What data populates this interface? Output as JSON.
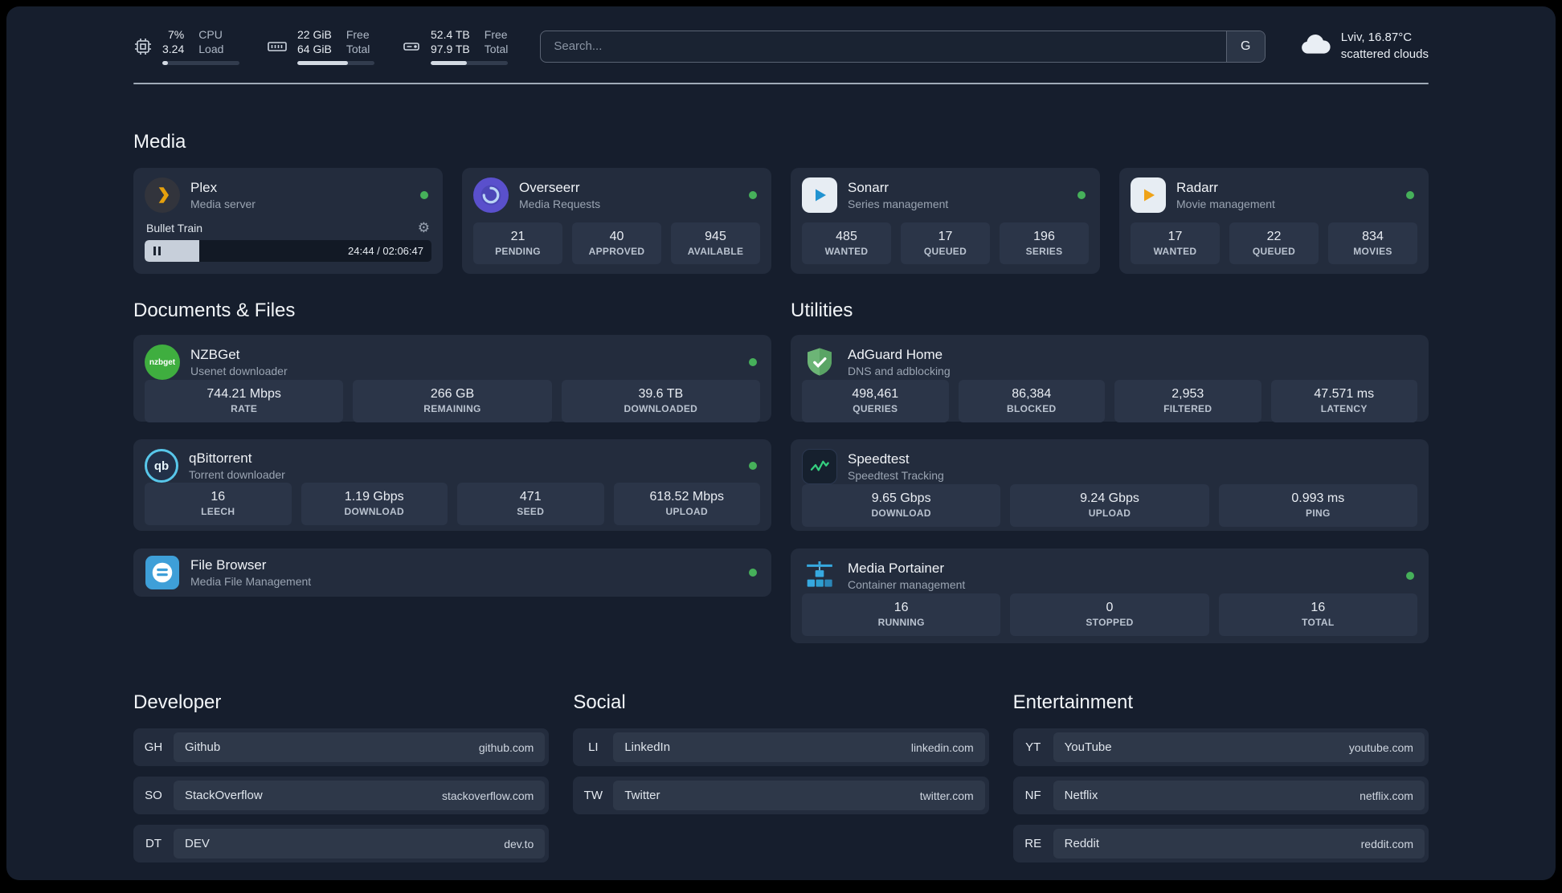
{
  "topbar": {
    "metrics": [
      {
        "primary": "7%",
        "secondary": "3.24",
        "label_top": "CPU",
        "label_bottom": "Load",
        "percent": 7
      },
      {
        "primary": "22 GiB",
        "secondary": "64 GiB",
        "label_top": "Free",
        "label_bottom": "Total",
        "percent": 66
      },
      {
        "primary": "52.4 TB",
        "secondary": "97.9 TB",
        "label_top": "Free",
        "label_bottom": "Total",
        "percent": 47
      }
    ],
    "search": {
      "placeholder": "Search...",
      "button_label": "G"
    },
    "weather": {
      "location": "Lviv, 16.87°C",
      "condition": "scattered clouds"
    }
  },
  "media": {
    "title": "Media",
    "plex": {
      "name": "Plex",
      "subtitle": "Media server",
      "now_playing": "Bullet Train",
      "time": "24:44 / 02:06:47",
      "progress_percent": 19
    },
    "overseerr": {
      "name": "Overseerr",
      "subtitle": "Media Requests",
      "stats": [
        {
          "value": "21",
          "label": "PENDING"
        },
        {
          "value": "40",
          "label": "APPROVED"
        },
        {
          "value": "945",
          "label": "AVAILABLE"
        }
      ]
    },
    "sonarr": {
      "name": "Sonarr",
      "subtitle": "Series management",
      "stats": [
        {
          "value": "485",
          "label": "WANTED"
        },
        {
          "value": "17",
          "label": "QUEUED"
        },
        {
          "value": "196",
          "label": "SERIES"
        }
      ]
    },
    "radarr": {
      "name": "Radarr",
      "subtitle": "Movie management",
      "stats": [
        {
          "value": "17",
          "label": "WANTED"
        },
        {
          "value": "22",
          "label": "QUEUED"
        },
        {
          "value": "834",
          "label": "MOVIES"
        }
      ]
    }
  },
  "documents": {
    "title": "Documents & Files",
    "nzbget": {
      "name": "NZBGet",
      "subtitle": "Usenet downloader",
      "icon_text": "nzbget",
      "stats": [
        {
          "value": "744.21 Mbps",
          "label": "RATE"
        },
        {
          "value": "266 GB",
          "label": "REMAINING"
        },
        {
          "value": "39.6 TB",
          "label": "DOWNLOADED"
        }
      ]
    },
    "qbittorrent": {
      "name": "qBittorrent",
      "subtitle": "Torrent downloader",
      "icon_text": "qb",
      "stats": [
        {
          "value": "16",
          "label": "LEECH"
        },
        {
          "value": "1.19 Gbps",
          "label": "DOWNLOAD"
        },
        {
          "value": "471",
          "label": "SEED"
        },
        {
          "value": "618.52 Mbps",
          "label": "UPLOAD"
        }
      ]
    },
    "filebrowser": {
      "name": "File Browser",
      "subtitle": "Media File Management"
    }
  },
  "utilities": {
    "title": "Utilities",
    "adguard": {
      "name": "AdGuard Home",
      "subtitle": "DNS and adblocking",
      "stats": [
        {
          "value": "498,461",
          "label": "QUERIES"
        },
        {
          "value": "86,384",
          "label": "BLOCKED"
        },
        {
          "value": "2,953",
          "label": "FILTERED"
        },
        {
          "value": "47.571 ms",
          "label": "LATENCY"
        }
      ]
    },
    "speedtest": {
      "name": "Speedtest",
      "subtitle": "Speedtest Tracking",
      "stats": [
        {
          "value": "9.65 Gbps",
          "label": "DOWNLOAD"
        },
        {
          "value": "9.24 Gbps",
          "label": "UPLOAD"
        },
        {
          "value": "0.993 ms",
          "label": "PING"
        }
      ]
    },
    "portainer": {
      "name": "Media Portainer",
      "subtitle": "Container management",
      "stats": [
        {
          "value": "16",
          "label": "RUNNING"
        },
        {
          "value": "0",
          "label": "STOPPED"
        },
        {
          "value": "16",
          "label": "TOTAL"
        }
      ]
    }
  },
  "bookmarks": {
    "developer": {
      "title": "Developer",
      "items": [
        {
          "abbr": "GH",
          "name": "Github",
          "url": "github.com"
        },
        {
          "abbr": "SO",
          "name": "StackOverflow",
          "url": "stackoverflow.com"
        },
        {
          "abbr": "DT",
          "name": "DEV",
          "url": "dev.to"
        }
      ]
    },
    "social": {
      "title": "Social",
      "items": [
        {
          "abbr": "LI",
          "name": "LinkedIn",
          "url": "linkedin.com"
        },
        {
          "abbr": "TW",
          "name": "Twitter",
          "url": "twitter.com"
        }
      ]
    },
    "entertainment": {
      "title": "Entertainment",
      "items": [
        {
          "abbr": "YT",
          "name": "YouTube",
          "url": "youtube.com"
        },
        {
          "abbr": "NF",
          "name": "Netflix",
          "url": "netflix.com"
        },
        {
          "abbr": "RE",
          "name": "Reddit",
          "url": "reddit.com"
        }
      ]
    }
  },
  "colors": {
    "background": "#161e2d",
    "card": "#232c3d",
    "stat_tile": "#2b3548",
    "status_green": "#46b05a",
    "plex_amber": "#e5a00d"
  }
}
